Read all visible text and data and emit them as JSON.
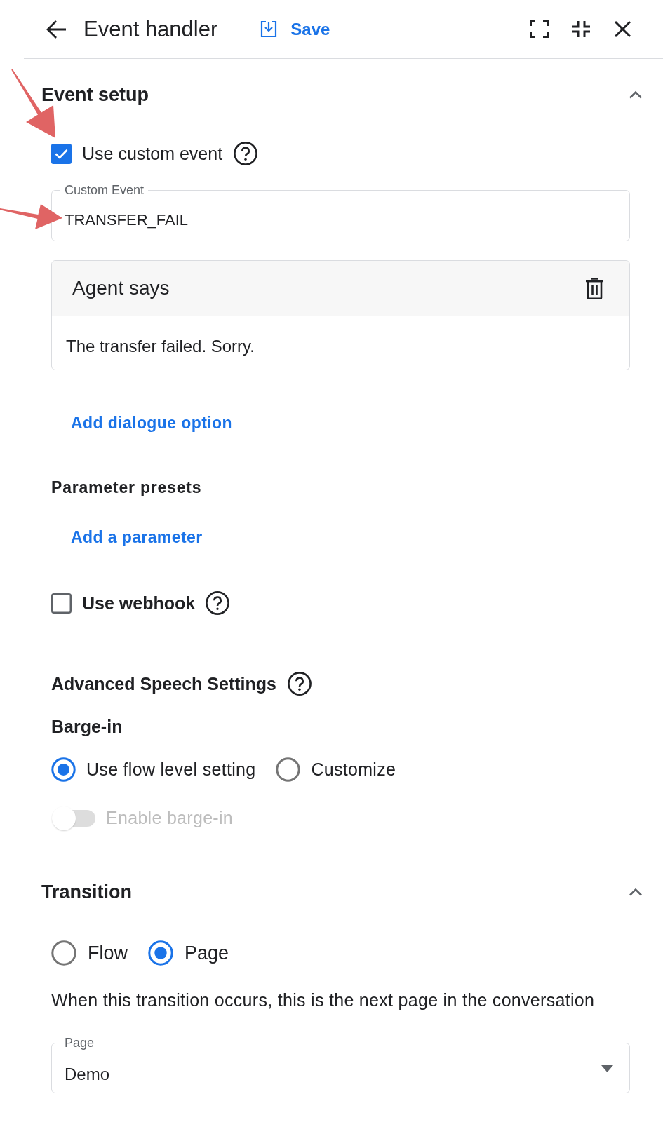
{
  "header": {
    "title": "Event handler",
    "save_label": "Save"
  },
  "event_setup": {
    "title": "Event setup",
    "expanded": true,
    "use_custom_event": {
      "label": "Use custom event",
      "checked": true
    },
    "custom_event": {
      "label": "Custom Event",
      "value": "TRANSFER_FAIL"
    },
    "agent_says": {
      "title": "Agent says",
      "text": "The transfer failed. Sorry."
    },
    "add_dialogue_option": "Add dialogue option",
    "parameter_presets": {
      "title": "Parameter presets",
      "add_link": "Add a parameter"
    },
    "use_webhook": {
      "label": "Use webhook",
      "checked": false
    },
    "advanced_speech": {
      "title": "Advanced Speech Settings",
      "barge_in": {
        "title": "Barge-in",
        "options": [
          {
            "label": "Use flow level setting",
            "selected": true
          },
          {
            "label": "Customize",
            "selected": false
          }
        ],
        "toggle": {
          "label": "Enable barge-in",
          "on": false,
          "disabled": true
        }
      }
    }
  },
  "transition": {
    "title": "Transition",
    "expanded": true,
    "options": [
      {
        "label": "Flow",
        "selected": false
      },
      {
        "label": "Page",
        "selected": true
      }
    ],
    "description": "When this transition occurs, this is the next page in the conversation",
    "page_field": {
      "label": "Page",
      "value": "Demo"
    }
  }
}
